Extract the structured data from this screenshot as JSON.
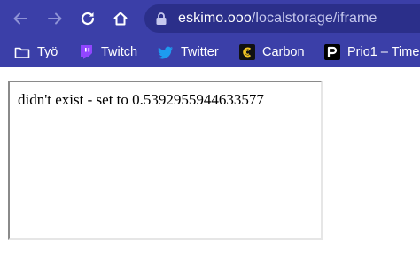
{
  "browser": {
    "accent_color": "#3b3fa8",
    "nav": {
      "back_icon": "arrow-left-icon",
      "forward_icon": "arrow-right-icon",
      "reload_icon": "reload-icon",
      "home_icon": "home-icon"
    },
    "address_bar": {
      "lock_icon": "lock-icon",
      "host": "eskimo.ooo",
      "path": "/localstorage/iframe"
    },
    "bookmarks": [
      {
        "label": "Työ",
        "icon": "folder-icon"
      },
      {
        "label": "Twitch",
        "icon": "twitch-icon",
        "color": "#9146ff"
      },
      {
        "label": "Twitter",
        "icon": "twitter-icon",
        "color": "#1d9bf0"
      },
      {
        "label": "Carbon",
        "icon": "carbon-icon"
      },
      {
        "label": "Prio1 – Time",
        "icon": "prio1-icon"
      }
    ]
  },
  "page": {
    "iframe_message": "didn't exist - set to 0.5392955944633577"
  }
}
